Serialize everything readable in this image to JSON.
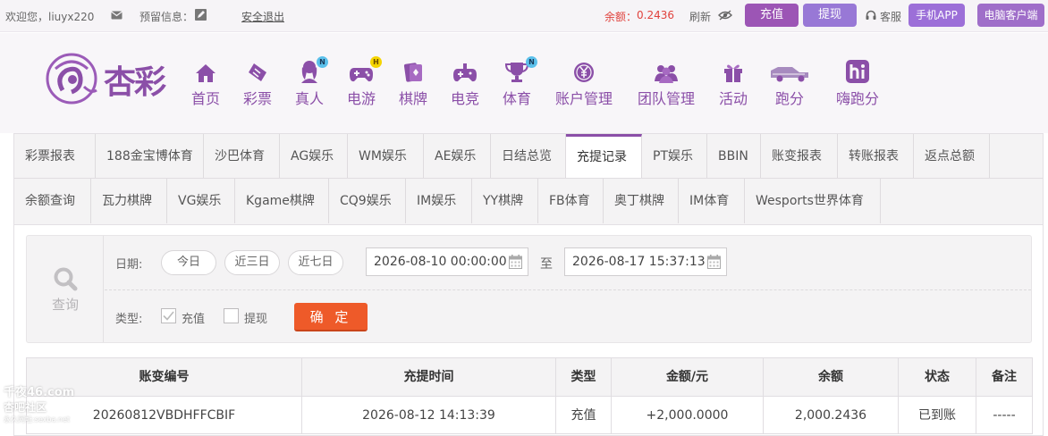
{
  "topbar": {
    "welcome": "欢迎您，liuyx220",
    "reserved_label": "预留信息：",
    "logout": "安全退出",
    "balance_label": "余额：",
    "balance_value": "0.2436",
    "refresh": "刷新",
    "deposit": "充值",
    "withdraw": "提现",
    "service": "客服",
    "mobile_app": "手机APP",
    "pc_client": "电脑客户端",
    "colors": {
      "deposit": "#9c55b5",
      "withdraw": "#9878d6",
      "app": "#9c6fd8",
      "client": "#9f6ec9"
    }
  },
  "header": {
    "logo_text": "杏彩",
    "nav": [
      {
        "label": "首页",
        "icon": "home-icon"
      },
      {
        "label": "彩票",
        "icon": "lottery-ticket-icon"
      },
      {
        "label": "真人",
        "icon": "live-dealer-icon",
        "badge": "N"
      },
      {
        "label": "电游",
        "icon": "gamepad-icon",
        "badge": "H"
      },
      {
        "label": "棋牌",
        "icon": "cards-icon"
      },
      {
        "label": "电竞",
        "icon": "esports-controller-icon"
      },
      {
        "label": "体育",
        "icon": "trophy-icon",
        "badge": "N"
      },
      {
        "label": "账户管理",
        "icon": "yen-coin-icon"
      },
      {
        "label": "团队管理",
        "icon": "team-icon"
      },
      {
        "label": "活动",
        "icon": "gift-icon"
      },
      {
        "label": "跑分",
        "icon": "race-car-icon"
      },
      {
        "label": "嗨跑分",
        "icon": "hi-logo-icon"
      }
    ]
  },
  "tabs": {
    "row1": [
      "彩票报表",
      "188金宝博体育",
      "沙巴体育",
      "AG娱乐",
      "WM娱乐",
      "AE娱乐",
      "日结总览",
      "充提记录",
      "PT娱乐",
      "BBIN",
      "账变报表",
      "转账报表",
      "返点总额"
    ],
    "row2": [
      "余额查询",
      "瓦力棋牌",
      "VG娱乐",
      "Kgame棋牌",
      "CQ9娱乐",
      "IM娱乐",
      "YY棋牌",
      "FB体育",
      "奥丁棋牌",
      "IM体育",
      "Wesports世界体育"
    ],
    "active": "充提记录"
  },
  "filter": {
    "query_label": "查询",
    "date_label": "日期:",
    "quick": [
      "今日",
      "近三日",
      "近七日"
    ],
    "start": "2026-08-10 00:00:00",
    "to": "至",
    "end": "2026-08-17 15:37:13",
    "type_label": "类型:",
    "type_deposit": "充值",
    "type_withdraw": "提现",
    "confirm": "确 定"
  },
  "table": {
    "headers": [
      "账变编号",
      "充提时间",
      "类型",
      "金额/元",
      "余额",
      "状态",
      "备注"
    ],
    "rows": [
      [
        "20260812VBDHFFCBIF",
        "2026-08-12 14:13:39",
        "充值",
        "+2,000.0000",
        "2,000.2436",
        "已到账",
        "-----"
      ]
    ]
  },
  "watermark": {
    "line1": "千夜46.com",
    "line2": "杏吧社区",
    "line3": "永久网址:sexba.net"
  }
}
